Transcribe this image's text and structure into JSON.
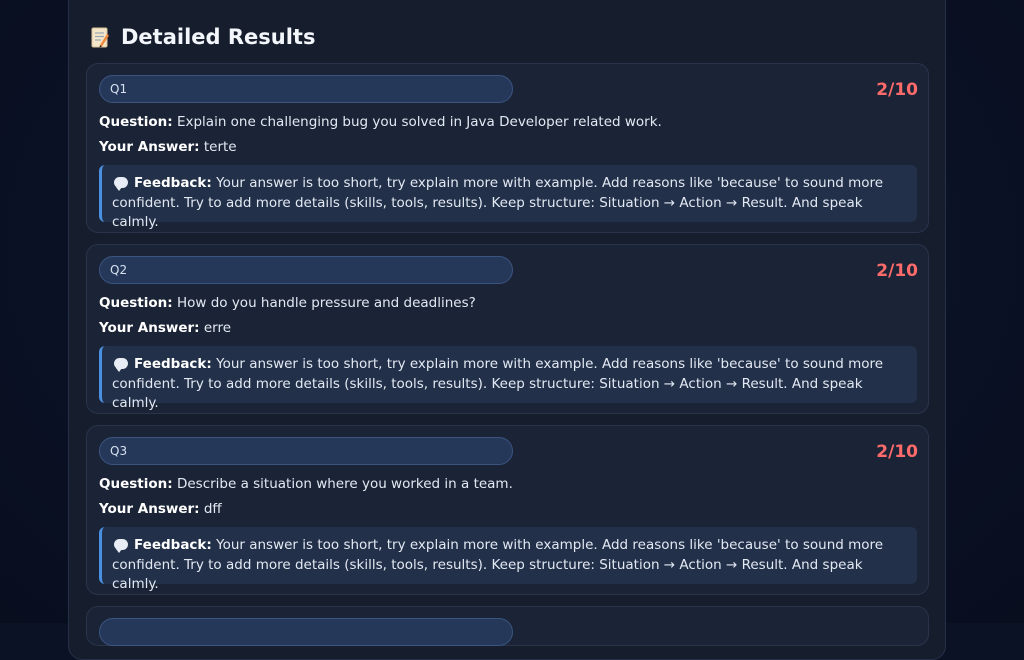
{
  "section": {
    "title": "Detailed Results",
    "icon": "memo-icon"
  },
  "labels": {
    "question": "Question:",
    "answer": "Your Answer:",
    "feedback": "Feedback:"
  },
  "results": [
    {
      "tag": "Q1",
      "score": "2/10",
      "question": "Explain one challenging bug you solved in Java Developer related work.",
      "answer": "terte",
      "feedback_line1": "Your answer is too short, try explain more with example. Add reasons like 'because' to sound more",
      "feedback_line2": "confident. Try to add more details (skills, tools, results). Keep structure: Situation → Action → Result. And speak calmly."
    },
    {
      "tag": "Q2",
      "score": "2/10",
      "question": "How do you handle pressure and deadlines?",
      "answer": "erre",
      "feedback_line1": "Your answer is too short, try explain more with example. Add reasons like 'because' to sound more",
      "feedback_line2": "confident. Try to add more details (skills, tools, results). Keep structure: Situation → Action → Result. And speak calmly."
    },
    {
      "tag": "Q3",
      "score": "2/10",
      "question": "Describe a situation where you worked in a team.",
      "answer": "dff",
      "feedback_line1": "Your answer is too short, try explain more with example. Add reasons like 'because' to sound more",
      "feedback_line2": "confident. Try to add more details (skills, tools, results). Keep structure: Situation → Action → Result. And speak calmly."
    }
  ],
  "colors": {
    "score": "#ff6b6b",
    "feedback_border": "#4a8fe0",
    "pill_bg": "#25385a"
  }
}
